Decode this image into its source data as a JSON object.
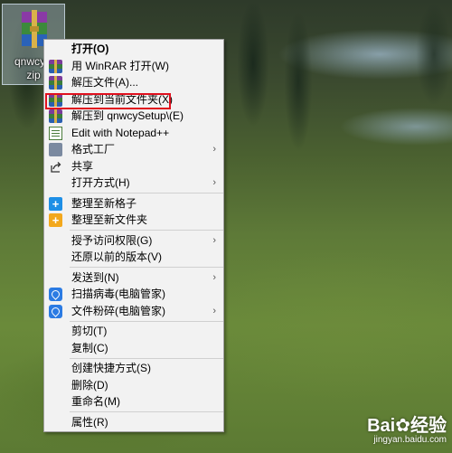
{
  "desktop": {
    "icon_label": "qnwcyS\nzip"
  },
  "context_menu": {
    "items": [
      {
        "label": "打开(O)",
        "icon": "none",
        "bold": true
      },
      {
        "label": "用 WinRAR 打开(W)",
        "icon": "winrar-icon"
      },
      {
        "label": "解压文件(A)...",
        "icon": "winrar-icon"
      },
      {
        "label": "解压到当前文件夹(X)",
        "icon": "winrar-icon",
        "highlighted": true
      },
      {
        "label": "解压到 qnwcySetup\\(E)",
        "icon": "winrar-icon"
      },
      {
        "label": "Edit with Notepad++",
        "icon": "notepad-icon"
      },
      {
        "label": "格式工厂",
        "icon": "format-factory-icon",
        "submenu": true
      },
      {
        "label": "共享",
        "icon": "share-icon"
      },
      {
        "label": "打开方式(H)",
        "icon": "none",
        "submenu": true
      },
      {
        "label": "整理至新格子",
        "icon": "blue-plus-icon"
      },
      {
        "label": "整理至新文件夹",
        "icon": "yellow-plus-icon"
      },
      {
        "label": "授予访问权限(G)",
        "icon": "none",
        "submenu": true
      },
      {
        "label": "还原以前的版本(V)",
        "icon": "none"
      },
      {
        "label": "发送到(N)",
        "icon": "none",
        "submenu": true
      },
      {
        "label": "扫描病毒(电脑管家)",
        "icon": "shield-icon"
      },
      {
        "label": "文件粉碎(电脑管家)",
        "icon": "shield-icon",
        "submenu": true
      },
      {
        "label": "剪切(T)",
        "icon": "none"
      },
      {
        "label": "复制(C)",
        "icon": "none"
      },
      {
        "label": "创建快捷方式(S)",
        "icon": "none"
      },
      {
        "label": "删除(D)",
        "icon": "none"
      },
      {
        "label": "重命名(M)",
        "icon": "none"
      },
      {
        "label": "属性(R)",
        "icon": "none"
      }
    ],
    "submenu_arrow": "›"
  },
  "watermark": {
    "brand": "Bai",
    "brand2": "经验",
    "paw": "✿",
    "url": "jingyan.baidu.com"
  },
  "colors": {
    "highlight_border": "#e0101e",
    "menu_bg": "#f2f2f2"
  }
}
